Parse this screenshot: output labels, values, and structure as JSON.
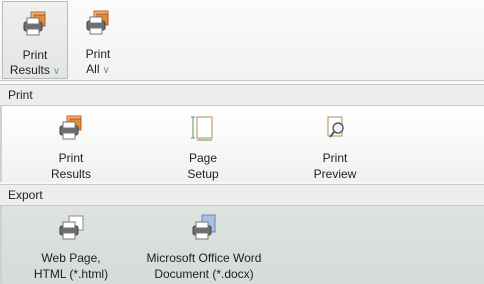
{
  "ribbon": {
    "print_results": {
      "line1": "Print",
      "line2": "Results"
    },
    "print_all": {
      "line1": "Print",
      "line2": "All"
    }
  },
  "sections": {
    "print": {
      "title": "Print",
      "items": [
        {
          "line1": "Print",
          "line2": "Results"
        },
        {
          "line1": "Page",
          "line2": "Setup"
        },
        {
          "line1": "Print",
          "line2": "Preview"
        }
      ]
    },
    "export": {
      "title": "Export",
      "items": [
        {
          "line1": "Web Page,",
          "line2": "HTML (*.html)"
        },
        {
          "line1": "Microsoft Office Word",
          "line2": "Document (*.docx)"
        }
      ]
    }
  },
  "colors": {
    "accent_orange": "#e58a3c",
    "accent_blue": "#a9c0e6",
    "chevron": "#7a9a7a"
  }
}
